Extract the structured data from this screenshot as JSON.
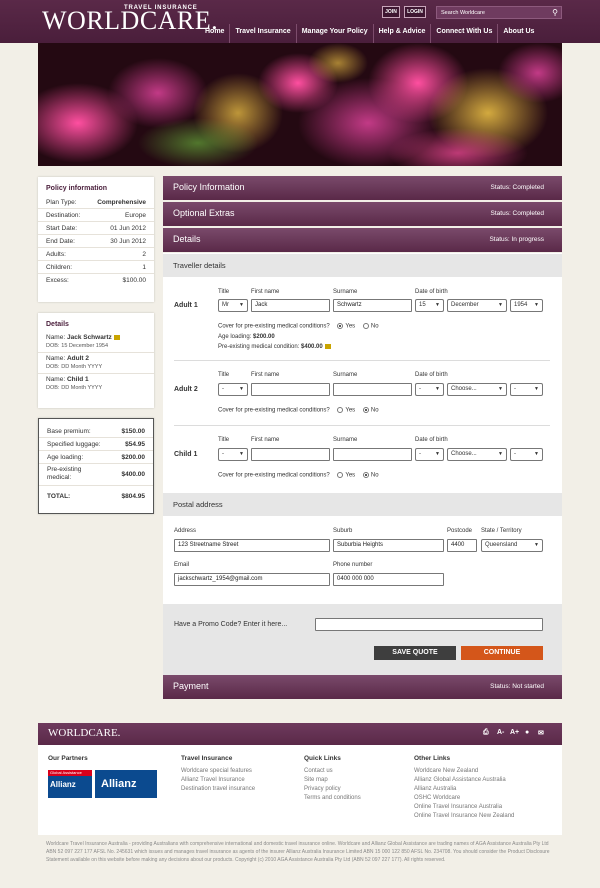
{
  "header": {
    "brand": "WORLDCARE.",
    "tagline": "TRAVEL INSURANCE",
    "join": "JOIN",
    "login": "LOGIN",
    "search_placeholder": "Search Worldcare",
    "nav": [
      "Home",
      "Travel Insurance",
      "Manage Your Policy",
      "Help & Advice",
      "Connect With Us",
      "About Us"
    ]
  },
  "policy_info": {
    "title": "Policy information",
    "rows": [
      {
        "k": "Plan Type:",
        "v": "Comprehensive"
      },
      {
        "k": "Destination:",
        "v": "Europe"
      },
      {
        "k": "Start Date:",
        "v": "01 Jun 2012"
      },
      {
        "k": "End Date:",
        "v": "30 Jun 2012"
      },
      {
        "k": "Adults:",
        "v": "2"
      },
      {
        "k": "Children:",
        "v": "1"
      },
      {
        "k": "Excess:",
        "v": "$100.00"
      }
    ]
  },
  "details_card": {
    "title": "Details",
    "people": [
      {
        "label": "Name:",
        "name": "Jack Schwartz",
        "dob_label": "DOB:",
        "dob": "15 December 1954"
      },
      {
        "label": "Name:",
        "name": "Adult 2",
        "dob_label": "DOB:",
        "dob": "DD Month YYYY"
      },
      {
        "label": "Name:",
        "name": "Child 1",
        "dob_label": "DOB:",
        "dob": "DD Month YYYY"
      }
    ]
  },
  "premium": {
    "rows": [
      {
        "k": "Base premium:",
        "v": "$150.00"
      },
      {
        "k": "Specified luggage:",
        "v": "$54.95"
      },
      {
        "k": "Age loading:",
        "v": "$200.00"
      },
      {
        "k": "Pre-existing medical:",
        "v": "$400.00"
      }
    ],
    "total_label": "TOTAL:",
    "total": "$804.95"
  },
  "sections": {
    "policy_information": {
      "title": "Policy Information",
      "status": "Status: Completed"
    },
    "optional_extras": {
      "title": "Optional Extras",
      "status": "Status: Completed"
    },
    "details": {
      "title": "Details",
      "status": "Status: In progress"
    },
    "payment": {
      "title": "Payment",
      "status": "Status: Not started"
    }
  },
  "traveller_details": {
    "heading": "Traveller details",
    "col_title": "Title",
    "col_first": "First name",
    "col_surname": "Surname",
    "col_dob": "Date of birth",
    "cover_q": "Cover for pre-existing medical conditions?",
    "yes": "Yes",
    "no": "No",
    "adult1": {
      "label": "Adult 1",
      "title": "Mr",
      "first": "Jack",
      "surname": "Schwartz",
      "day": "15",
      "month": "December",
      "year": "1954",
      "age_loading_label": "Age loading:",
      "age_loading": "$200.00",
      "premed_label": "Pre-existing medical condition:",
      "premed": "$400.00"
    },
    "adult2": {
      "label": "Adult 2",
      "title": "-",
      "day": "-",
      "month": "Choose...",
      "year": "-"
    },
    "child1": {
      "label": "Child 1",
      "title": "-",
      "day": "-",
      "month": "Choose...",
      "year": "-"
    }
  },
  "postal": {
    "heading": "Postal address",
    "address_label": "Address",
    "address": "123 Streetname Street",
    "suburb_label": "Suburb",
    "suburb": "Suburbia Heights",
    "postcode_label": "Postcode",
    "postcode": "4400",
    "state_label": "State / Territory",
    "state": "Queensland",
    "email_label": "Email",
    "email": "jackschwartz_1954@gmail.com",
    "phone_label": "Phone number",
    "phone": "0400 000 000"
  },
  "promo": {
    "label": "Have a Promo Code?  Enter it here...",
    "value": ""
  },
  "actions": {
    "save": "SAVE QUOTE",
    "continue": "CONTINUE"
  },
  "footer": {
    "brand": "WORLDCARE.",
    "tools": [
      "A-",
      "A+"
    ],
    "partners_title": "Our Partners",
    "partner1_top": "Global Assistance",
    "partner1_name": "Allianz",
    "partner2_name": "Allianz",
    "travel_title": "Travel Insurance",
    "travel_links": [
      "Worldcare special features",
      "Allianz Travel Insurance",
      "Destination travel insurance"
    ],
    "quick_title": "Quick Links",
    "quick_links": [
      "Contact us",
      "Site map",
      "Privacy policy",
      "Terms and conditions"
    ],
    "other_title": "Other Links",
    "other_links": [
      "Worldcare New Zealand",
      "Allianz Global Assistance Australia",
      "Allianz Australia",
      "OSHC Worldcare",
      "Online Travel Insurance Australia",
      "Online Travel Insurance New Zealand"
    ],
    "legal": "Worldcare Travel Insurance Australia - providing Australians with comprehensive international and domestic travel insurance online. Worldcare and Allianz Global Assistance are trading names of AGA Assistance Australia Pty Ltd ABN 52 097 227 177 AFSL No. 245631 which issues and manages travel insurance as agents of the insurer Allianz Australia Insurance Limited ABN 15 000 122 850 AFSL No. 234708. You should consider the Product Disclosure Statement available on this website before making any decisions about our products. Copyright (c) 2010 AGA Assistance Australia Pty Ltd (ABN 52 097 227 177). All rights reserved."
  },
  "colors": {
    "plum": "#5a2948",
    "save_btn": "#3e3e3e",
    "continue_btn": "#d4561a",
    "allianz_blue": "#0b4a8f"
  }
}
